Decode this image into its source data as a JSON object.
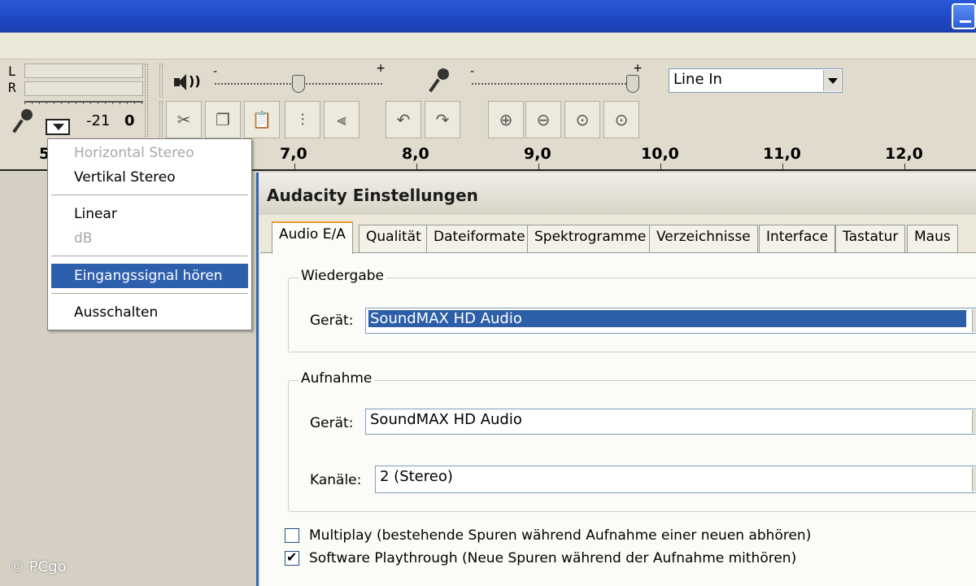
{
  "toolbar": {
    "meter": {
      "left_channel": "L",
      "right_channel": "R",
      "db_left": "-21",
      "db_right": "0"
    },
    "output_slider": {
      "minus": "-",
      "plus": "+",
      "level_fraction": 0.5
    },
    "input_slider": {
      "minus": "-",
      "plus": "+",
      "level_fraction": 1.0
    },
    "input_source": "Line In"
  },
  "timeline": {
    "ticks": [
      "5",
      "7,0",
      "8,0",
      "9,0",
      "10,0",
      "11,0",
      "12,0"
    ]
  },
  "meter_menu": {
    "items": [
      {
        "label": "Horizontal Stereo",
        "disabled": true
      },
      {
        "label": "Vertikal Stereo",
        "disabled": false
      },
      {
        "label": "Linear",
        "disabled": false
      },
      {
        "label": "dB",
        "disabled": true
      },
      {
        "label": "Eingangssignal hören",
        "highlighted": true
      },
      {
        "label": "Ausschalten",
        "disabled": false
      }
    ]
  },
  "dialog": {
    "title": "Audacity Einstellungen",
    "tabs": [
      "Audio E/A",
      "Qualität",
      "Dateiformate",
      "Spektrogramme",
      "Verzeichnisse",
      "Interface",
      "Tastatur",
      "Maus"
    ],
    "active_tab": "Audio E/A",
    "playback": {
      "legend": "Wiedergabe",
      "device_label": "Gerät:",
      "device_value": "SoundMAX HD Audio"
    },
    "recording": {
      "legend": "Aufnahme",
      "device_label": "Gerät:",
      "device_value": "SoundMAX HD Audio",
      "channels_label": "Kanäle:",
      "channels_value": "2 (Stereo)"
    },
    "options": [
      {
        "label": "Multiplay (bestehende Spuren während Aufnahme einer neuen abhören)",
        "checked": false
      },
      {
        "label": "Software Playthrough (Neue Spuren während der Aufnahme mithören)",
        "checked": true
      }
    ]
  },
  "watermark": "© PCgo"
}
